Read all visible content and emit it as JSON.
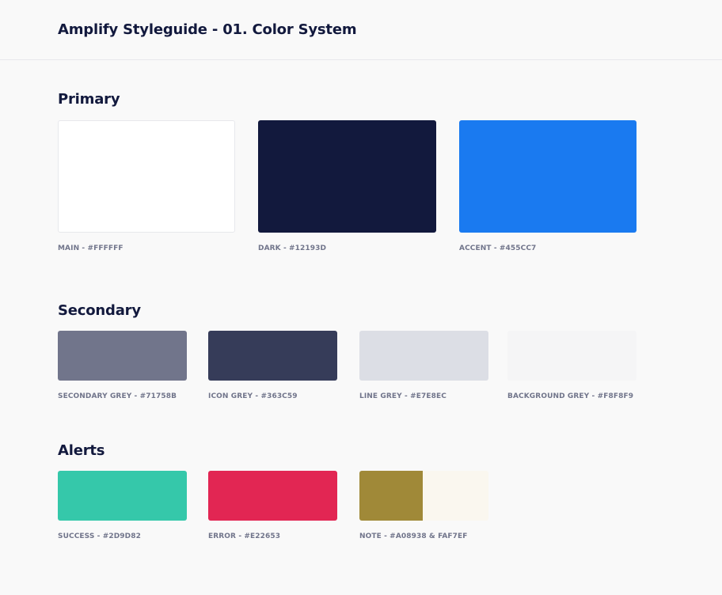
{
  "header": {
    "title": "Amplify Styleguide - 01. Color System"
  },
  "sections": {
    "primary": {
      "title": "Primary",
      "swatches": [
        {
          "label": "MAIN - #FFFFFF",
          "color": "#FFFFFF",
          "border": "#E7E8EC"
        },
        {
          "label": "DARK - #12193D",
          "color": "#12193D"
        },
        {
          "label": "ACCENT - #455CC7",
          "color": "#1A7AF0"
        }
      ]
    },
    "secondary": {
      "title": "Secondary",
      "swatches": [
        {
          "label": "SECONDARY GREY - #71758B",
          "color": "#71758B"
        },
        {
          "label": "ICON GREY - #363C59",
          "color": "#363C59"
        },
        {
          "label": "LINE GREY - #E7E8EC",
          "color": "#DCDEE5"
        },
        {
          "label": "BACKGROUND GREY - #F8F8F9",
          "color": "#F5F5F6"
        }
      ]
    },
    "alerts": {
      "title": "Alerts",
      "swatches": [
        {
          "label": "SUCCESS - #2D9D82",
          "color": "#35C8AA"
        },
        {
          "label": "ERROR - #E22653",
          "color": "#E22653"
        },
        {
          "label": "NOTE - #A08938 & FAF7EF",
          "color": "#A08938",
          "color2": "#FAF7EF"
        }
      ]
    }
  }
}
